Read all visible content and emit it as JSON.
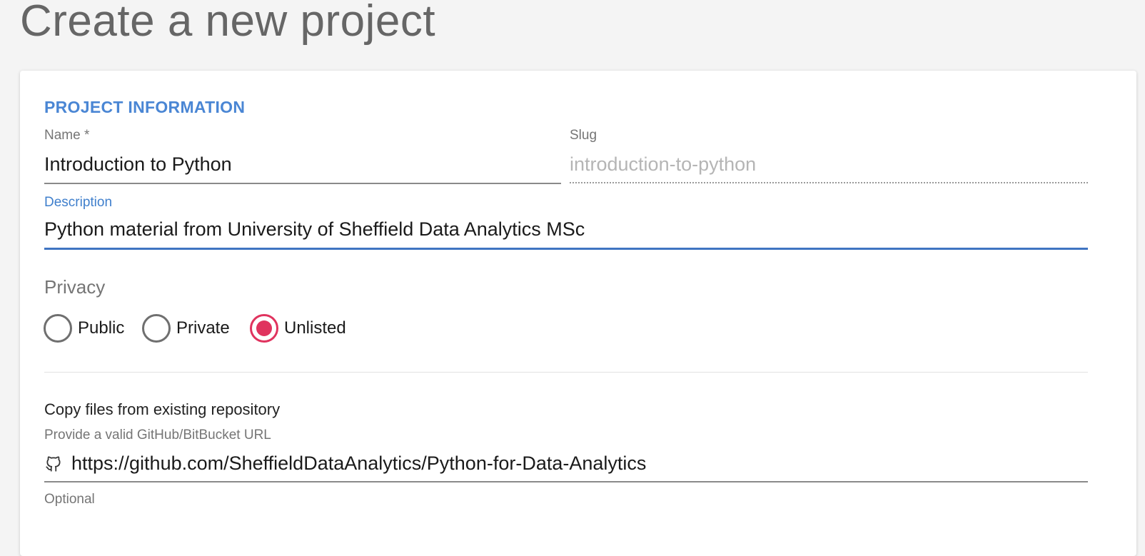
{
  "page": {
    "title": "Create a new project"
  },
  "form": {
    "section_heading": "PROJECT INFORMATION",
    "name": {
      "label": "Name *",
      "value": "Introduction to Python"
    },
    "slug": {
      "label": "Slug",
      "value": "introduction-to-python"
    },
    "description": {
      "label": "Description",
      "value": "Python material from University of Sheffield Data Analytics MSc"
    },
    "privacy": {
      "label": "Privacy",
      "options": [
        {
          "label": "Public",
          "checked": false
        },
        {
          "label": "Private",
          "checked": false
        },
        {
          "label": "Unlisted",
          "checked": true
        }
      ],
      "selected": "Unlisted"
    },
    "copy_repo": {
      "heading": "Copy files from existing repository",
      "label": "Provide a valid GitHub/BitBucket URL",
      "value": "https://github.com/SheffieldDataAnalytics/Python-for-Data-Analytics",
      "icon": "github-icon",
      "helper": "Optional"
    }
  },
  "colors": {
    "accent_blue": "#3f74c2",
    "heading_blue": "#4a86d4",
    "radio_selected": "#e0335e"
  }
}
